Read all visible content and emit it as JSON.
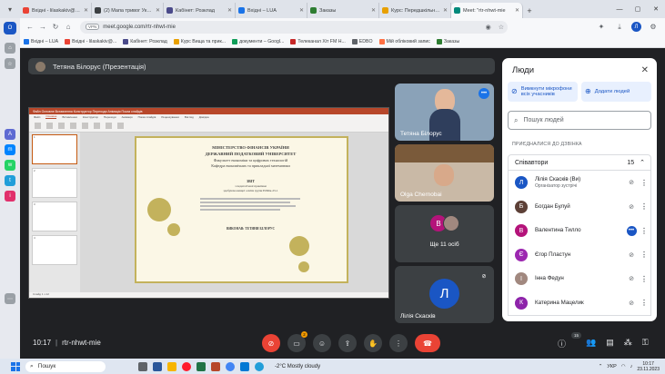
{
  "browser": {
    "tabs": [
      {
        "label": "Вхідні - lilaskakiv@gmai",
        "color": "#ea4335",
        "active": false
      },
      {
        "label": "(2) Мапа тривог України",
        "color": "#3c4043",
        "active": false
      },
      {
        "label": "Кабінет: Розклад",
        "color": "#4a4a8a",
        "active": false
      },
      {
        "label": "Вхідні – LUA",
        "color": "#1a73e8",
        "active": false
      },
      {
        "label": "Заказы",
        "color": "#2e7d32",
        "active": false
      },
      {
        "label": "Курс: Передшкільна п",
        "color": "#e8a000",
        "active": false
      },
      {
        "label": "Meet: \"rtr-nhwt-mie",
        "color": "#00897b",
        "active": true
      }
    ],
    "url": "meet.google.com/rtr-nhwt-mie",
    "vpn_label": "VPN",
    "profile_initial": "Л",
    "bookmarks": [
      {
        "label": "Вхідні – LUA",
        "color": "#1a73e8"
      },
      {
        "label": "Вхідні - lilaskakiv@...",
        "color": "#ea4335"
      },
      {
        "label": "Кабінет: Розклад",
        "color": "#4a4a8a"
      },
      {
        "label": "Курс Вища та прик...",
        "color": "#e8a000"
      },
      {
        "label": "документи – Googl...",
        "color": "#0f9d58"
      },
      {
        "label": "Телеканал Хіт FM Н...",
        "color": "#c62828"
      },
      {
        "label": "EDBO",
        "color": "#5f6368"
      },
      {
        "label": "Мій обліковий запис",
        "color": "#ff7043"
      },
      {
        "label": "Заказы",
        "color": "#2e7d32"
      }
    ]
  },
  "meet": {
    "presenter_label": "Тетяна Білорус (Презентація)",
    "time": "10:17",
    "separator": "|",
    "code": "rtr-nhwt-mie",
    "tiles": [
      {
        "name": "Тетяна Білорус"
      },
      {
        "name": "Olga Chernobai"
      },
      {
        "name": "Ще 11 осіб",
        "initial": "В"
      },
      {
        "name": "Лілія Скасків",
        "initial": "Л"
      }
    ],
    "reactions_badge": "2",
    "participants_count": "15",
    "slide": {
      "app_title": "Файл  Основне  Вставлення  Конструктор  Переходи  Анімація  Показ слайдів",
      "tabs": [
        "Файл",
        "Основне",
        "Вставлення",
        "Конструктор",
        "Переходи",
        "Анімація",
        "Показ слайдів",
        "Рецензування",
        "Вигляд",
        "Довідка"
      ],
      "line1": "МІНІСТЕРСТВО ФІНАНСІВ УКРАЇНИ",
      "line2": "ДЕРЖАВНИЙ ПОДАТКОВИЙ УНІВЕРСИТЕТ",
      "line3": "Факультет економіки та цифрових технологій",
      "line4": "Кафедра економічних та прикладної математики",
      "line5": "ЗВІТ",
      "line6": "з педагогічної практики",
      "line7": "здобувача вищої освіти групи ЕЛФм-23-1",
      "line8": "ВИКОНАВ: ТЕТЯНИ БІЛОРУС",
      "thumb_numbers": [
        "1",
        "2",
        "3",
        "4"
      ],
      "status": "Слайд 1 з 12"
    }
  },
  "people_panel": {
    "title": "Люди",
    "mute_all": "Вимкнути мікрофони всіх учасників",
    "add_people": "Додати людей",
    "search_placeholder": "Пошук людей",
    "section": "ПРИЄДНАЛИСЯ ДО ДЗВІНКА",
    "group": "Співавтори",
    "group_count": "15",
    "participants": [
      {
        "initial": "Л",
        "name": "Лілія Скасків (Ви)",
        "sub": "Організатор зустрічі",
        "color": "#1a56c4"
      },
      {
        "initial": "Б",
        "name": "Богдан Булуй",
        "sub": "",
        "color": "#5d4037"
      },
      {
        "initial": "В",
        "name": "Валентина Тилло",
        "sub": "",
        "color": "#b4137a"
      },
      {
        "initial": "Є",
        "name": "Єгор Пластун",
        "sub": "",
        "color": "#9c27b0"
      },
      {
        "initial": "І",
        "name": "Інна Федун",
        "sub": "",
        "color": "#a1887f"
      },
      {
        "initial": "К",
        "name": "Катерина Мацелик",
        "sub": "",
        "color": "#8e24aa"
      }
    ]
  },
  "taskbar": {
    "search": "Пошук",
    "weather": "-2°C  Mostly cloudy",
    "lang": "УКР",
    "time": "10:17",
    "date": "23.11.2023"
  }
}
